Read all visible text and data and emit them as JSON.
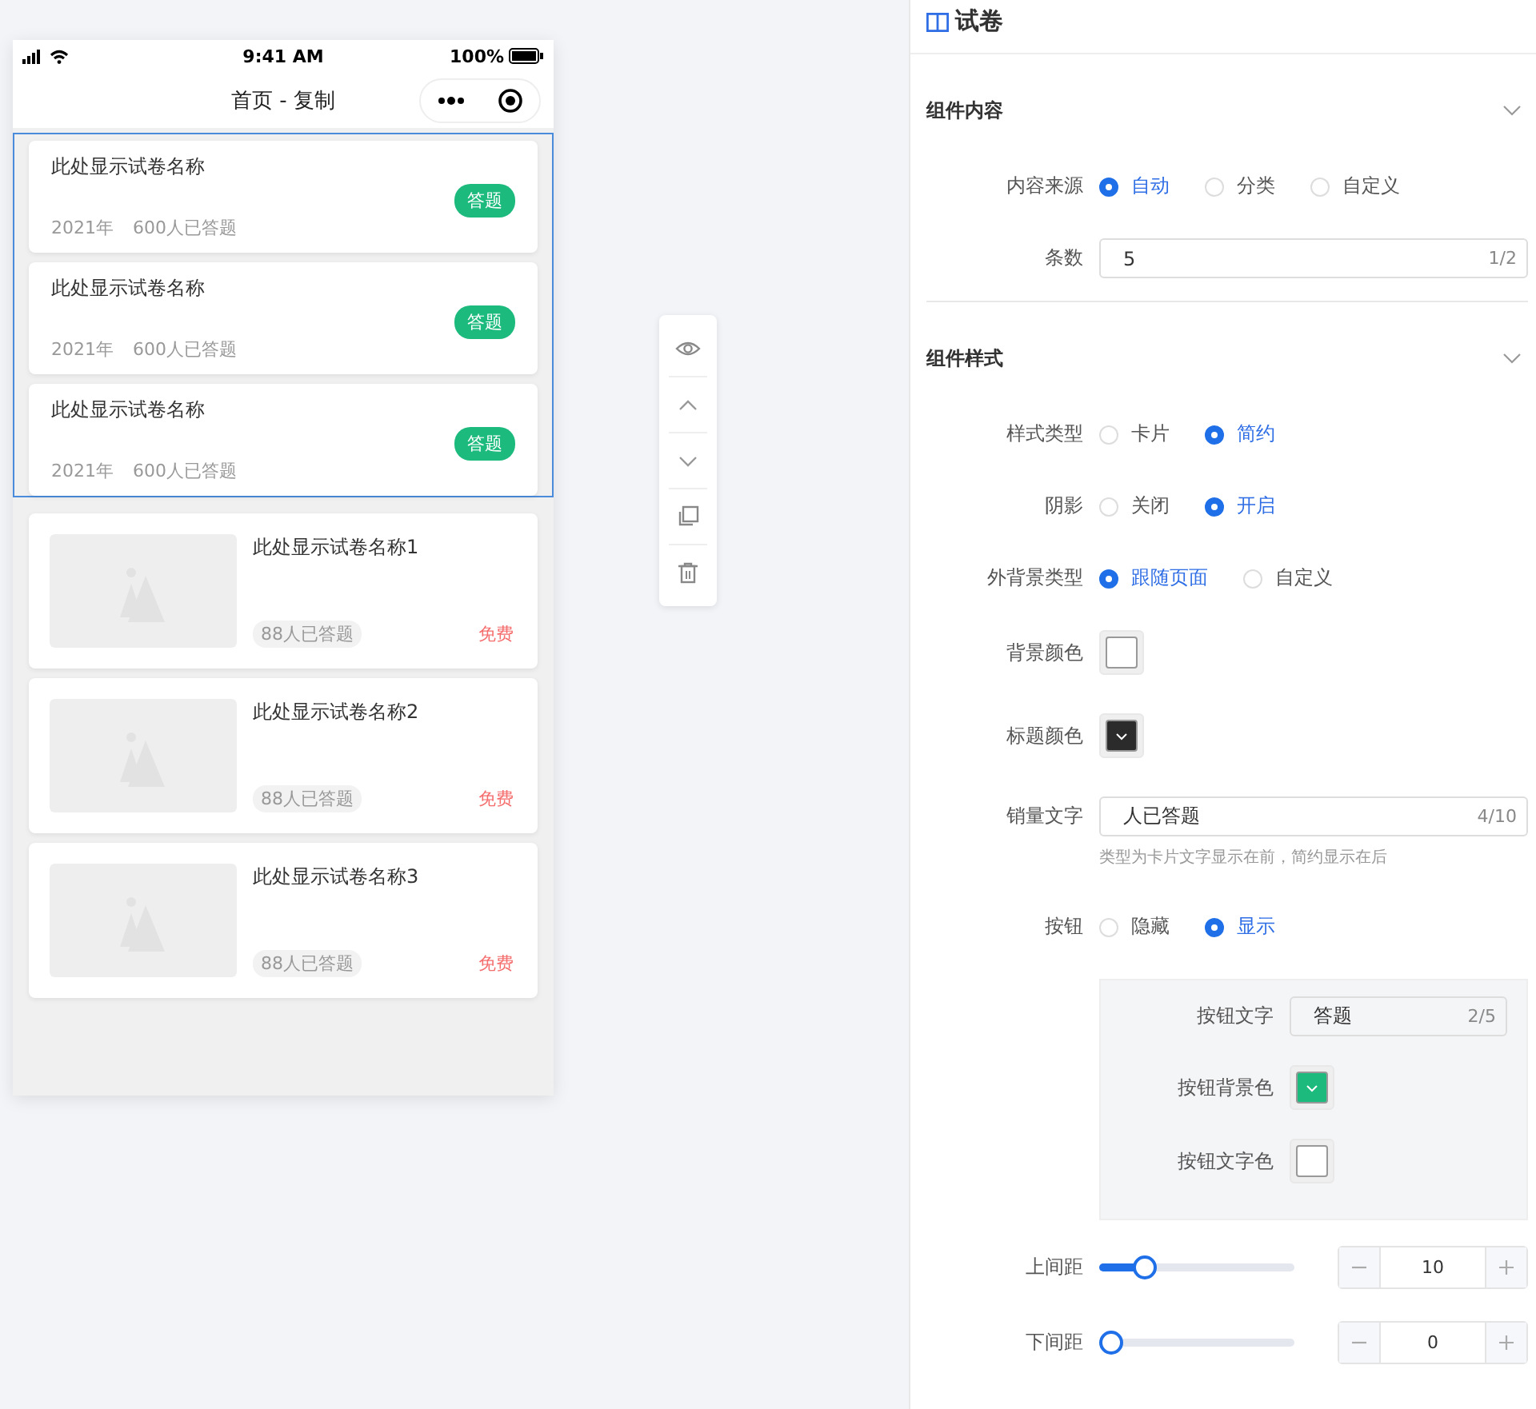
{
  "phone": {
    "status_bar": {
      "time": "9:41 AM",
      "battery": "100%"
    },
    "title": "首页 - 复制",
    "blocks": [
      {
        "kind": "simple",
        "selected": true,
        "items": [
          {
            "title": "此处显示试卷名称",
            "year": "2021年",
            "count": "600人已答题",
            "button": "答题"
          },
          {
            "title": "此处显示试卷名称",
            "year": "2021年",
            "count": "600人已答题",
            "button": "答题"
          },
          {
            "title": "此处显示试卷名称",
            "year": "2021年",
            "count": "600人已答题",
            "button": "答题"
          }
        ]
      },
      {
        "selected": false,
        "items": [
          {
            "title": "此处显示试卷名称1",
            "count": "88人已答题",
            "price": "免费"
          },
          {
            "title": "此处显示试卷名称2",
            "count": "88人已答题",
            "price": "免费"
          },
          {
            "title": "此处显示试卷名称3",
            "count": "88人已答题",
            "price": "免费"
          }
        ]
      }
    ]
  },
  "panel": {
    "title": "试卷",
    "sections": [
      {
        "title": "组件内容",
        "expanded": true,
        "fields": [
          {
            "kind": "radio",
            "label": "内容来源",
            "options": [
              {
                "label": "自动",
                "selected": true
              },
              {
                "label": "分类",
                "selected": false
              },
              {
                "label": "自定义",
                "selected": false
              }
            ]
          },
          {
            "kind": "input",
            "label": "条数",
            "value": "5",
            "count": "1/2"
          }
        ]
      },
      {
        "title": "组件样式",
        "expanded": true,
        "fields": [
          {
            "kind": "radio",
            "label": "样式类型",
            "options": [
              {
                "label": "卡片",
                "selected": false
              },
              {
                "label": "简约",
                "selected": true
              }
            ]
          },
          {
            "kind": "radio",
            "label": "阴影",
            "options": [
              {
                "label": "关闭",
                "selected": false
              },
              {
                "label": "开启",
                "selected": true
              }
            ]
          },
          {
            "kind": "radio",
            "label": "外背景类型",
            "options": [
              {
                "label": "跟随页面",
                "selected": true
              },
              {
                "label": "自定义",
                "selected": false
              }
            ]
          },
          {
            "kind": "color",
            "label": "背景颜色",
            "color": "#ffffff"
          },
          {
            "kind": "color",
            "label": "标题颜色",
            "color": "#2b2b2b"
          },
          {
            "kind": "input",
            "label": "销量文字",
            "value": "人已答题",
            "count": "4/10"
          },
          {
            "kind": "hint",
            "text": "类型为卡片文字显示在前，简约显示在后"
          },
          {
            "kind": "radio",
            "label": "按钮",
            "options": [
              {
                "label": "隐藏",
                "selected": false
              },
              {
                "label": "显示",
                "selected": true
              }
            ]
          },
          {
            "kind": "group",
            "fields": [
              {
                "kind": "input",
                "label": "按钮文字",
                "value": "答题",
                "count": "2/5"
              },
              {
                "kind": "color",
                "label": "按钮背景色",
                "color": "#1dba7e"
              },
              {
                "kind": "color",
                "label": "按钮文字色",
                "color": "#ffffff"
              }
            ]
          },
          {
            "kind": "slider",
            "label": "上间距",
            "level": 0.2,
            "value": "10"
          },
          {
            "kind": "slider",
            "label": "下间距",
            "level": 0,
            "value": "0"
          }
        ]
      }
    ]
  }
}
